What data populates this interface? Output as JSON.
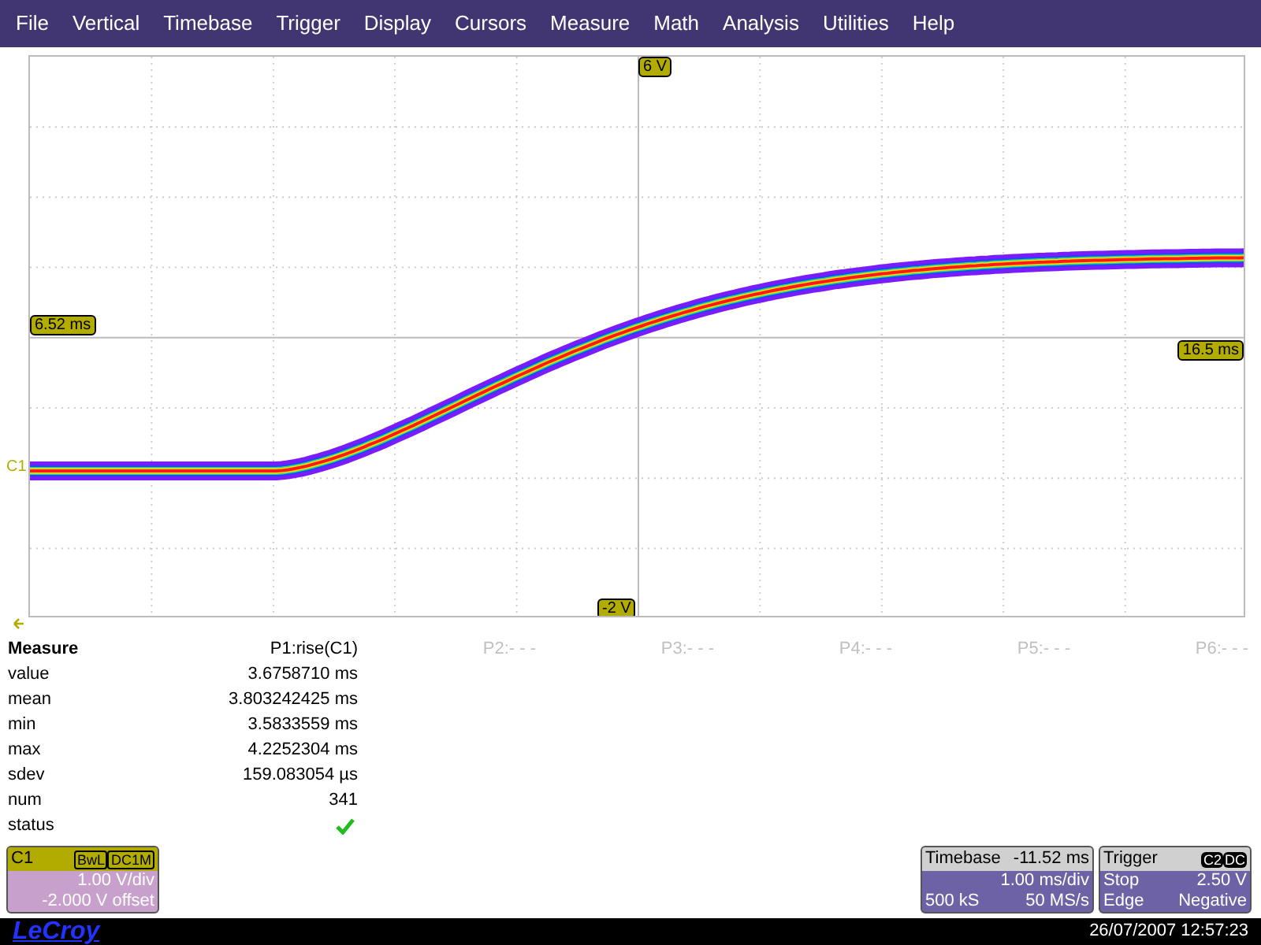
{
  "menu": [
    "File",
    "Vertical",
    "Timebase",
    "Trigger",
    "Display",
    "Cursors",
    "Measure",
    "Math",
    "Analysis",
    "Utilities",
    "Help"
  ],
  "graticule": {
    "top_label": "6 V",
    "bottom_label": "-2 V",
    "left_time": "6.52 ms",
    "right_time": "16.5 ms",
    "channel_marker": "C1"
  },
  "measure": {
    "title": "Measure",
    "params": [
      {
        "label": "P1:rise(C1)",
        "active": true
      },
      {
        "label": "P2:- - -",
        "active": false
      },
      {
        "label": "P3:- - -",
        "active": false
      },
      {
        "label": "P4:- - -",
        "active": false
      },
      {
        "label": "P5:- - -",
        "active": false
      },
      {
        "label": "P6:- - -",
        "active": false
      }
    ],
    "rows": [
      {
        "label": "value",
        "value": "3.6758710 ms"
      },
      {
        "label": "mean",
        "value": "3.803242425 ms"
      },
      {
        "label": "min",
        "value": "3.5833559 ms"
      },
      {
        "label": "max",
        "value": "4.2252304 ms"
      },
      {
        "label": "sdev",
        "value": "159.083054 µs"
      },
      {
        "label": "num",
        "value": "341"
      }
    ],
    "status": {
      "label": "status",
      "ok": true
    }
  },
  "channel": {
    "name": "C1",
    "tags": [
      "BwL",
      "DC1M"
    ],
    "scale": "1.00 V/div",
    "offset": "-2.000 V offset"
  },
  "timebase": {
    "title": "Timebase",
    "delay": "-11.52 ms",
    "scale": "1.00 ms/div",
    "samples": "500 kS",
    "rate": "50 MS/s"
  },
  "trigger": {
    "title": "Trigger",
    "tags": [
      "C2",
      "DC"
    ],
    "mode": "Stop",
    "level": "2.50 V",
    "type": "Edge",
    "slope": "Negative"
  },
  "footer": {
    "brand": "LeCroy",
    "datetime": "26/07/2007 12:57:23"
  }
}
